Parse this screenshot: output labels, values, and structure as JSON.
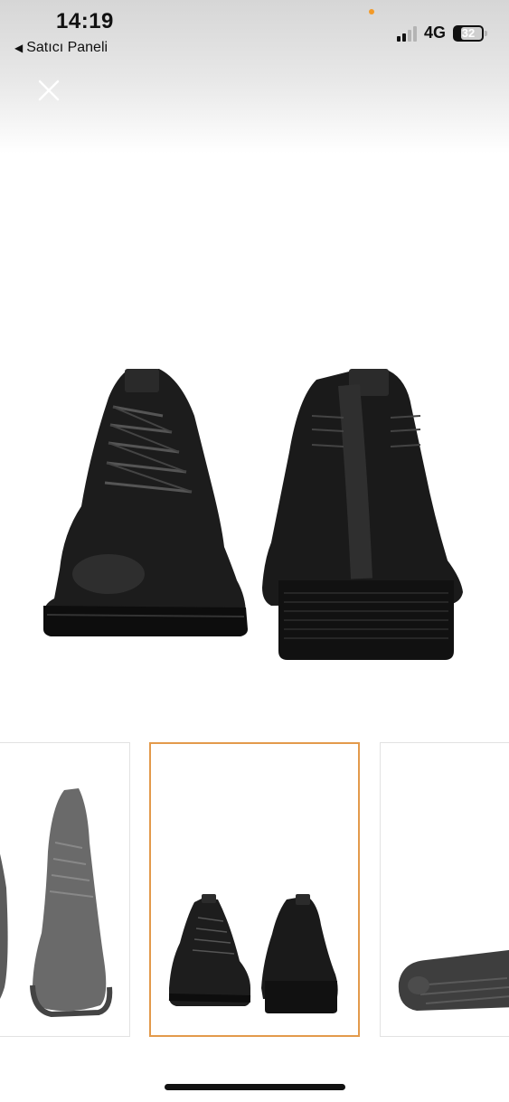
{
  "status_bar": {
    "time": "14:19",
    "back_label": "Satıcı Paneli",
    "network": "4G",
    "battery": "32",
    "signal_bars_active": 2
  },
  "viewer": {
    "close_icon": "close-icon",
    "thumbnails": [
      {
        "name": "thumbnail-1",
        "active": false
      },
      {
        "name": "thumbnail-2",
        "active": true
      },
      {
        "name": "thumbnail-3",
        "active": false
      }
    ],
    "accent_color": "#e39a4b"
  }
}
